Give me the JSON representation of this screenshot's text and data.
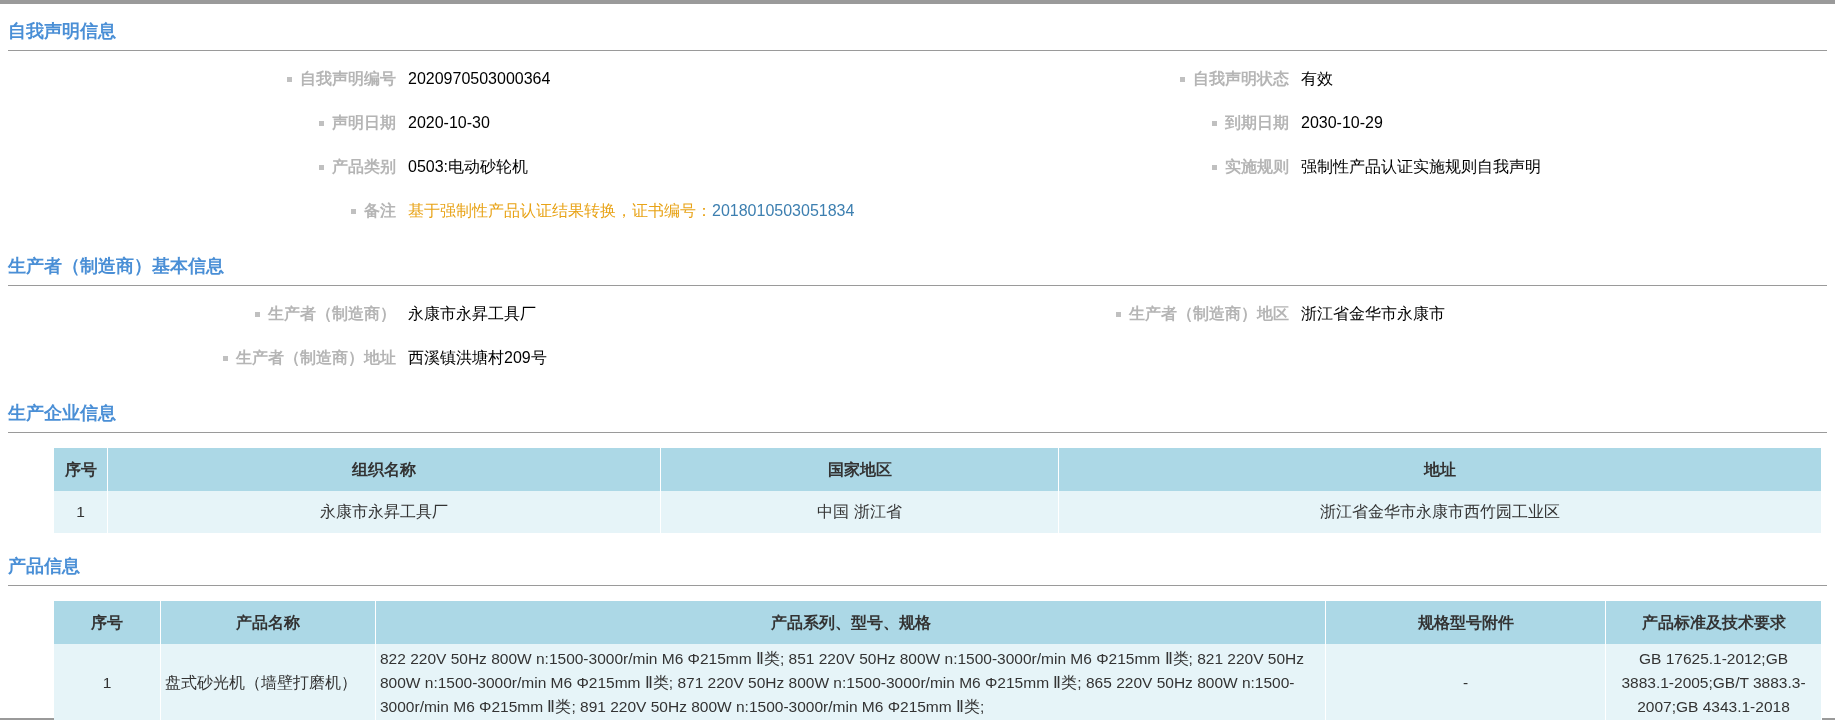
{
  "sections": [
    {
      "kind": "fields",
      "title": "自我声明信息",
      "rows": [
        {
          "left": {
            "label": "自我声明编号",
            "value": "2020970503000364"
          },
          "right": {
            "label": "自我声明状态",
            "value": "有效"
          }
        },
        {
          "left": {
            "label": "声明日期",
            "value": "2020-10-30"
          },
          "right": {
            "label": "到期日期",
            "value": "2030-10-29"
          }
        },
        {
          "left": {
            "label": "产品类别",
            "value": "0503:电动砂轮机"
          },
          "right": {
            "label": "实施规则",
            "value": "强制性产品认证实施规则自我声明"
          }
        },
        {
          "left": {
            "label": "备注",
            "note": "基于强制性产品认证结果转换，证书编号：",
            "link": "2018010503051834"
          }
        }
      ]
    },
    {
      "kind": "fields",
      "title": "生产者（制造商）基本信息",
      "rows": [
        {
          "left": {
            "label": "生产者（制造商）",
            "value": "永康市永昇工具厂"
          },
          "right": {
            "label": "生产者（制造商）地区",
            "value": "浙江省金华市永康市"
          }
        },
        {
          "left": {
            "label": "生产者（制造商）地址",
            "value": "西溪镇洪塘村209号"
          }
        }
      ]
    },
    {
      "kind": "table",
      "title": "生产企业信息",
      "columns": [
        "序号",
        "组织名称",
        "国家地区",
        "地址"
      ],
      "rows": [
        [
          "1",
          "永康市永昇工具厂",
          "中国 浙江省",
          "浙江省金华市永康市西竹园工业区"
        ]
      ]
    },
    {
      "kind": "table",
      "title": "产品信息",
      "columns": [
        "序号",
        "产品名称",
        "产品系列、型号、规格",
        "规格型号附件",
        "产品标准及技术要求"
      ],
      "rows": [
        [
          "1",
          "盘式砂光机（墙壁打磨机）",
          "822 220V 50Hz 800W n:1500-3000r/min M6 Φ215mm Ⅱ类; 851 220V 50Hz 800W n:1500-3000r/min M6 Φ215mm Ⅱ类; 821 220V 50Hz 800W n:1500-3000r/min M6 Φ215mm Ⅱ类; 871 220V 50Hz 800W n:1500-3000r/min M6 Φ215mm Ⅱ类; 865 220V 50Hz 800W n:1500-3000r/min M6 Φ215mm Ⅱ类; 891 220V 50Hz 800W n:1500-3000r/min M6 Φ215mm Ⅱ类;",
          "-",
          "GB 17625.1-2012;GB 3883.1-2005;GB/T 3883.3-2007;GB 4343.1-2018"
        ]
      ]
    }
  ]
}
